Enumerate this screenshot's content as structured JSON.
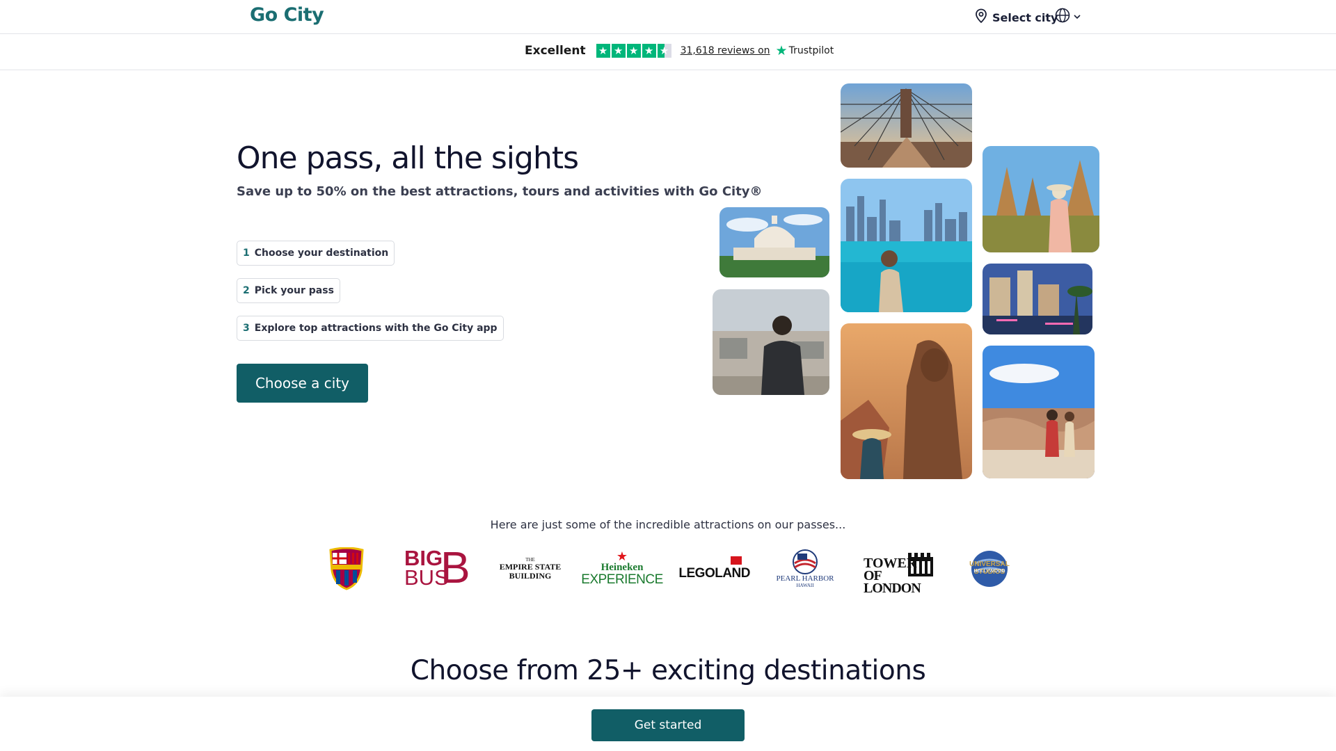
{
  "header": {
    "logo_text": "Go City",
    "select_city_label": "Select city"
  },
  "trustpilot": {
    "rating_word": "Excellent",
    "reviews_text": "31,618 reviews on",
    "brand": "Trustpilot",
    "stars": 4.5,
    "accent_color": "#00b67a"
  },
  "hero": {
    "title": "One pass, all the sights",
    "subtitle": "Save up to 50% on the best attractions, tours and activities with Go City®",
    "steps": [
      {
        "num": "1",
        "label": "Choose your destination"
      },
      {
        "num": "2",
        "label": "Pick your pass"
      },
      {
        "num": "3",
        "label": "Explore top attractions with the Go City app"
      }
    ],
    "cta_label": "Choose a city"
  },
  "attractions": {
    "intro": "Here are just some of the incredible attractions on our passes...",
    "logos": [
      {
        "name": "FC Barcelona",
        "icon": "fcb-crest"
      },
      {
        "name": "Big Bus",
        "line1": "BIG",
        "line2": "BUS",
        "mark": "B"
      },
      {
        "name": "Empire State Building",
        "line0": "THE",
        "line1": "EMPIRE STATE",
        "line2": "BUILDING"
      },
      {
        "name": "Heineken Experience",
        "line1": "Heineken",
        "line2": "EXPERIENCE"
      },
      {
        "name": "Legoland",
        "line1": "LEGOLAND"
      },
      {
        "name": "Pearl Harbor Hawaii",
        "line1": "PEARL HARBOR",
        "line2": "HAWAII"
      },
      {
        "name": "Tower of London",
        "line1": "TOWER",
        "line2": "OF LONDON"
      },
      {
        "name": "Universal Studios Hollywood",
        "line1": "UNIVERSAL STUDIOS",
        "line2": "HOLLYWOOD"
      }
    ]
  },
  "destinations": {
    "title": "Choose from 25+ exciting destinations"
  },
  "sticky_footer": {
    "button_label": "Get started"
  },
  "colors": {
    "brand_teal": "#115e66",
    "logo_teal": "#1b6e72",
    "text_dark": "#11142d"
  }
}
